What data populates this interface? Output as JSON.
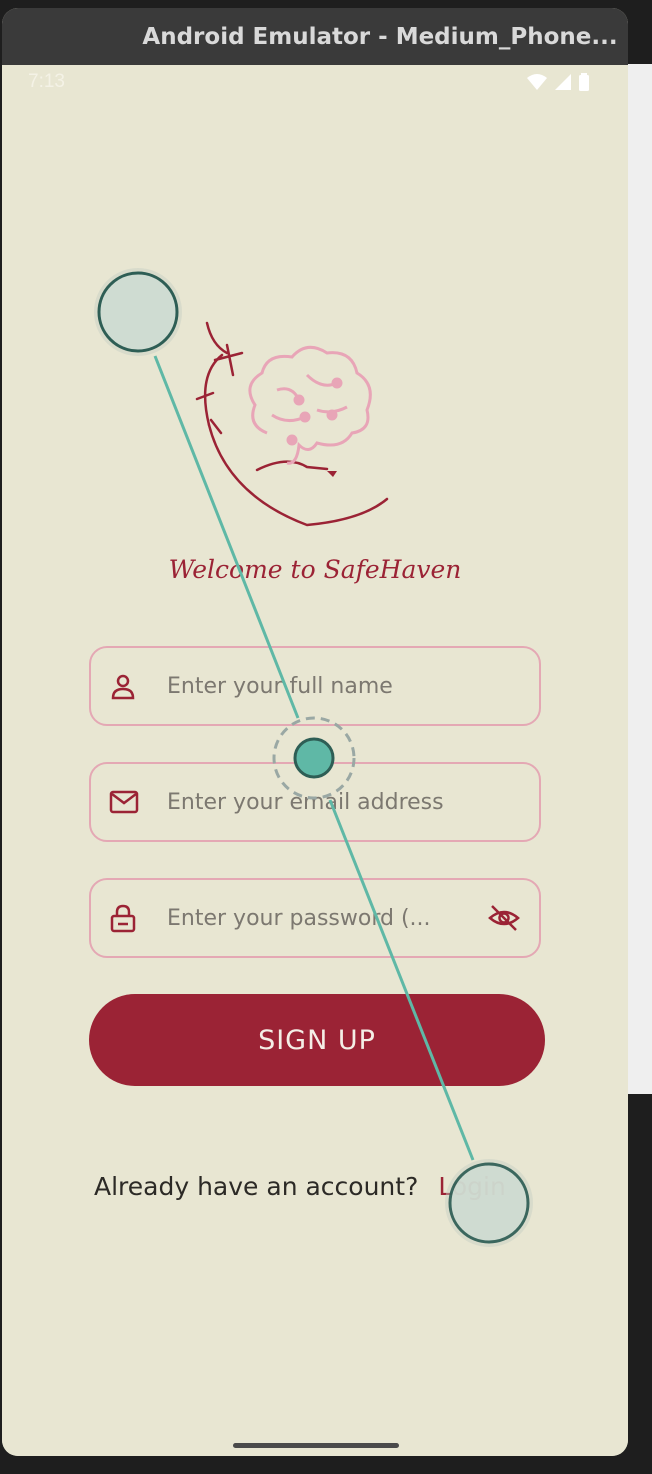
{
  "window": {
    "title": "Android Emulator - Medium_Phone..."
  },
  "status": {
    "time": "7:13"
  },
  "app": {
    "welcome": "Welcome to SafeHaven"
  },
  "form": {
    "name_placeholder": "Enter your full name",
    "email_placeholder": "Enter your email address",
    "password_placeholder": "Enter your password (...",
    "signup_label": "SIGN UP"
  },
  "footer": {
    "question": "Already have an account?",
    "login_label": "Login"
  },
  "colors": {
    "accent": "#9b2335",
    "border": "#e4a8b4",
    "background": "#e8e6d2",
    "gesture": "#5fb8a6"
  },
  "icons": [
    "person-icon",
    "mail-icon",
    "lock-icon",
    "eye-off-icon",
    "wifi-icon",
    "signal-icon",
    "battery-icon"
  ]
}
